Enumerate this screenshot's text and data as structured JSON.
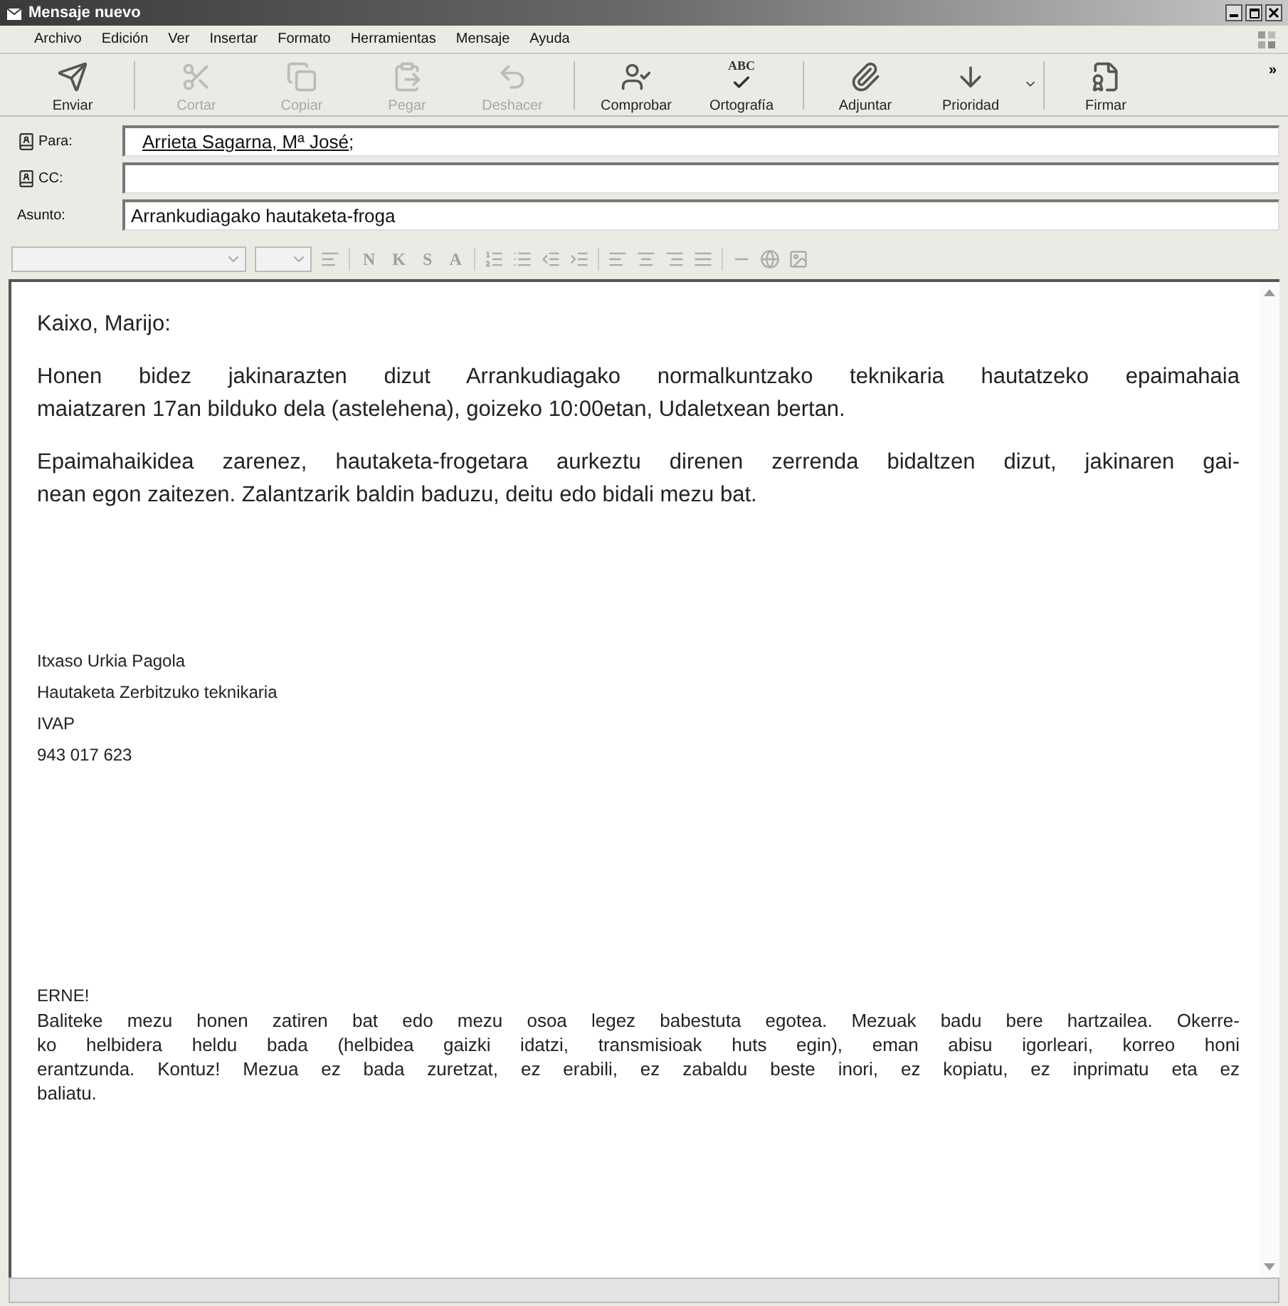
{
  "window": {
    "title": "Mensaje nuevo"
  },
  "menu": [
    "Archivo",
    "Edición",
    "Ver",
    "Insertar",
    "Formato",
    "Herramientas",
    "Mensaje",
    "Ayuda"
  ],
  "toolbar": [
    {
      "label": "Enviar",
      "kind": "send",
      "disabled": false
    },
    {
      "label": "Cortar",
      "kind": "cut",
      "disabled": true
    },
    {
      "label": "Copiar",
      "kind": "copy",
      "disabled": true
    },
    {
      "label": "Pegar",
      "kind": "paste",
      "disabled": true
    },
    {
      "label": "Deshacer",
      "kind": "undo",
      "disabled": true
    },
    {
      "label": "Comprobar",
      "kind": "check",
      "disabled": false
    },
    {
      "label": "Ortografía",
      "kind": "spell",
      "disabled": false,
      "glyph": "ABC"
    },
    {
      "label": "Adjuntar",
      "kind": "attach",
      "disabled": false
    },
    {
      "label": "Prioridad",
      "kind": "priority",
      "disabled": false,
      "dropdown": true
    },
    {
      "label": "Firmar",
      "kind": "sign",
      "disabled": false
    }
  ],
  "toolbar_overflow": "»",
  "fields": [
    {
      "label": "Para:",
      "value": "Arrieta Sagarna, Mª José;",
      "kind": "recipient",
      "link": true
    },
    {
      "label": "CC:",
      "kind": "recipient"
    },
    {
      "label": "Asunto:",
      "value": "Arrankudiagako hautaketa-froga",
      "kind": "subject",
      "link": false
    }
  ],
  "format_toolbar": {
    "letters": [
      "N",
      "K",
      "S",
      "A"
    ]
  },
  "body": {
    "greeting": "Kaixo, Marijo:",
    "paragraphs": [
      [
        "Honen bidez jakinarazten dizut Arrankudiagako normalkuntzako teknikaria hautatzeko epaimahaia",
        "maiatzaren 17an bilduko dela (astelehena), goizeko 10:00etan, Udaletxean bertan."
      ],
      [
        "Epaimahaikidea zarenez, hautaketa-frogetara aurkeztu direnen zerrenda bidaltzen dizut, jakinaren gai-",
        "nean egon zaitezen. Zalantzarik baldin baduzu, deitu edo bidali mezu bat."
      ]
    ],
    "signature": [
      "Itxaso Urkia Pagola",
      "Hautaketa Zerbitzuko teknikaria",
      "IVAP",
      "943 017 623"
    ],
    "notice_title": "ERNE!",
    "notice": [
      "Baliteke mezu honen zatiren bat edo mezu osoa legez babestuta egotea. Mezuak badu bere hartzailea. Okerre-",
      "ko helbidera heldu bada (helbidea gaizki idatzi, transmisioak huts egin), eman abisu igorleari, korreo honi",
      "erantzunda. Kontuz! Mezua ez bada zuretzat, ez erabili, ez zabaldu beste inori, ez kopiatu, ez inprimatu eta ez",
      "baliatu."
    ]
  }
}
